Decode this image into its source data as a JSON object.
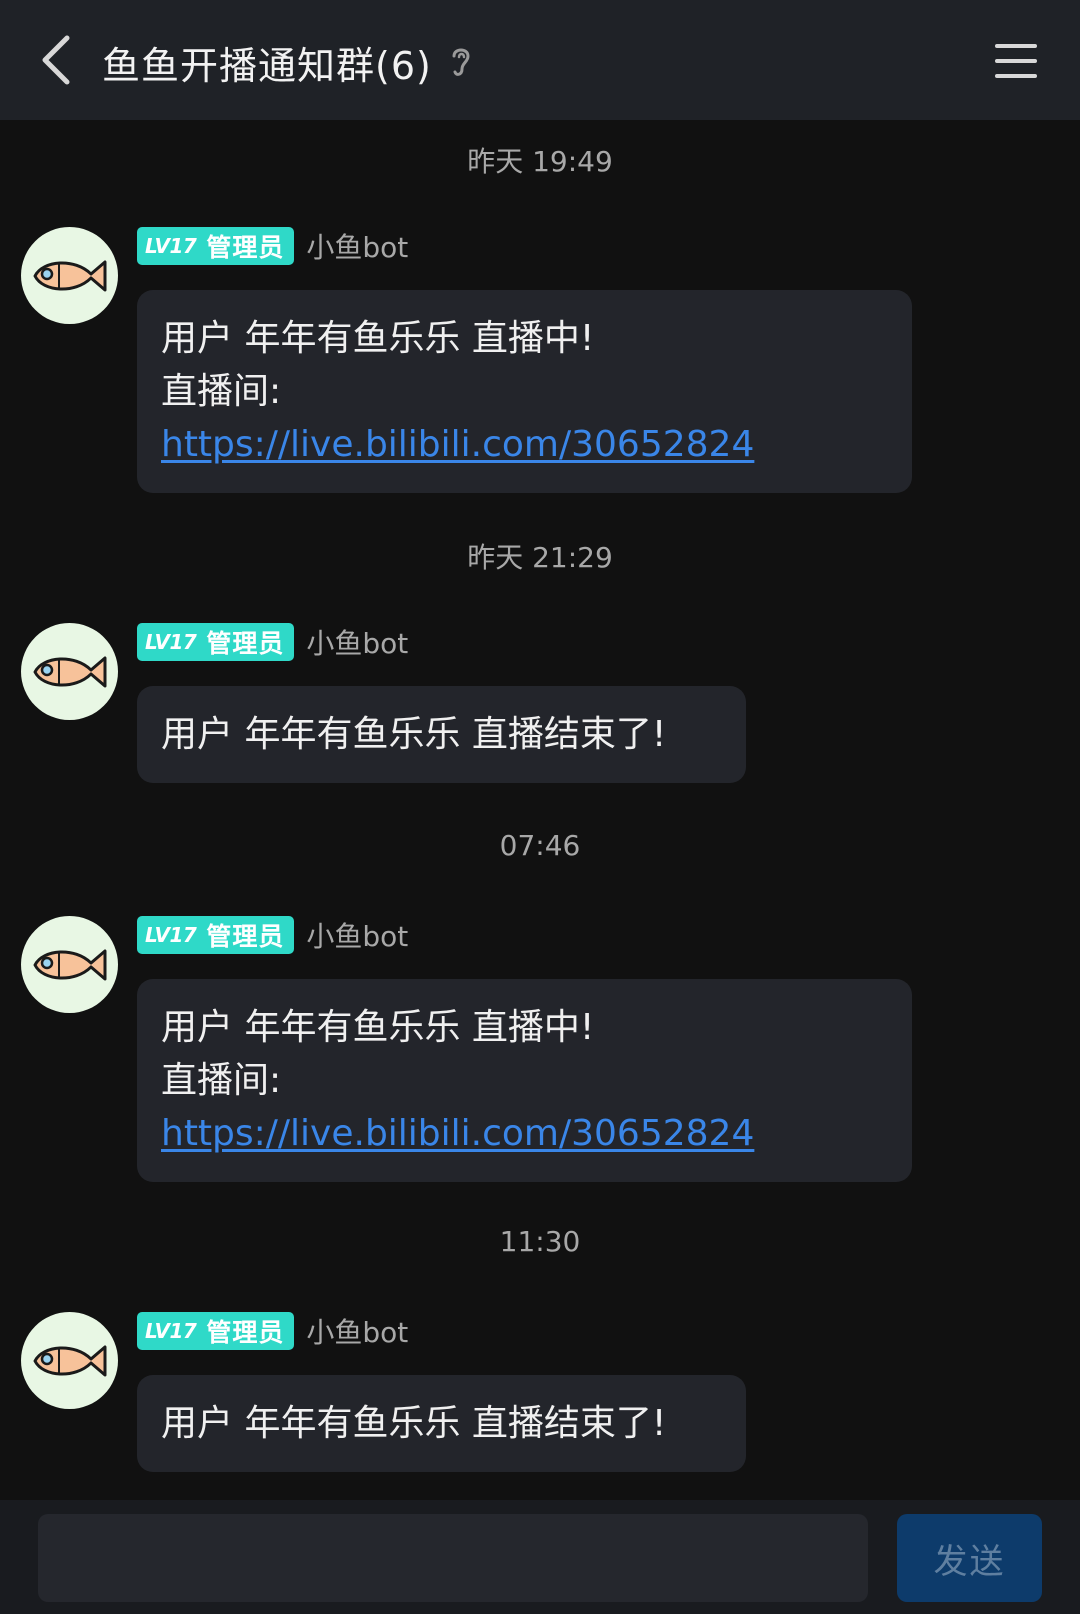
{
  "header": {
    "title": "鱼鱼开播通知群(6)",
    "back_icon": "chevron-left-icon",
    "ear_icon": "ear-icon",
    "menu_icon": "hamburger-menu-icon"
  },
  "badge_color": "#2fd9c8",
  "link_color": "#3a86e8",
  "messages": [
    {
      "timestamp": "昨天 19:49",
      "badge_level": "LV17",
      "badge_role": "管理员",
      "sender": "小鱼bot",
      "line1": "用户 年年有鱼乐乐 直播中!",
      "line2": "直播间:",
      "link": "https://live.bilibili.com/30652824"
    },
    {
      "timestamp": "昨天 21:29",
      "badge_level": "LV17",
      "badge_role": "管理员",
      "sender": "小鱼bot",
      "line1": "用户 年年有鱼乐乐 直播结束了!"
    },
    {
      "timestamp": "07:46",
      "badge_level": "LV17",
      "badge_role": "管理员",
      "sender": "小鱼bot",
      "line1": "用户 年年有鱼乐乐 直播中!",
      "line2": "直播间:",
      "link": "https://live.bilibili.com/30652824"
    },
    {
      "timestamp": "11:30",
      "badge_level": "LV17",
      "badge_role": "管理员",
      "sender": "小鱼bot",
      "line1": "用户 年年有鱼乐乐 直播结束了!"
    }
  ],
  "composer": {
    "input_value": "",
    "input_placeholder": "",
    "send_label": "发送"
  }
}
